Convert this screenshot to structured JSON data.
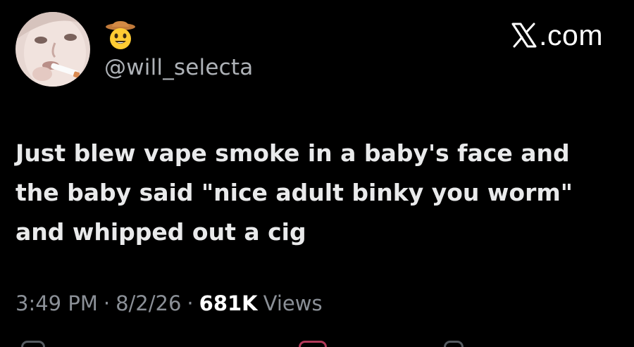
{
  "author": {
    "handle": "@will_selecta",
    "emoji_icon": "cowboy-hat-face-icon"
  },
  "brand": {
    "logo_icon": "x-logo-icon",
    "domain": ".com"
  },
  "tweet": {
    "text": "Just blew vape smoke in a baby's face and\nthe baby said \"nice adult binky you worm\"\nand whipped out a cig"
  },
  "meta": {
    "time": "3:49 PM",
    "separator": "·",
    "date": "8/2/26",
    "views_count": "681K",
    "views_label": "Views"
  },
  "actions": [
    {
      "name": "reply-icon"
    },
    {
      "name": "like-icon"
    },
    {
      "name": "share-icon"
    }
  ],
  "colors": {
    "background": "#000000",
    "text": "#e9eaeb",
    "muted": "#8b9097",
    "handle": "#aeb2b7"
  }
}
